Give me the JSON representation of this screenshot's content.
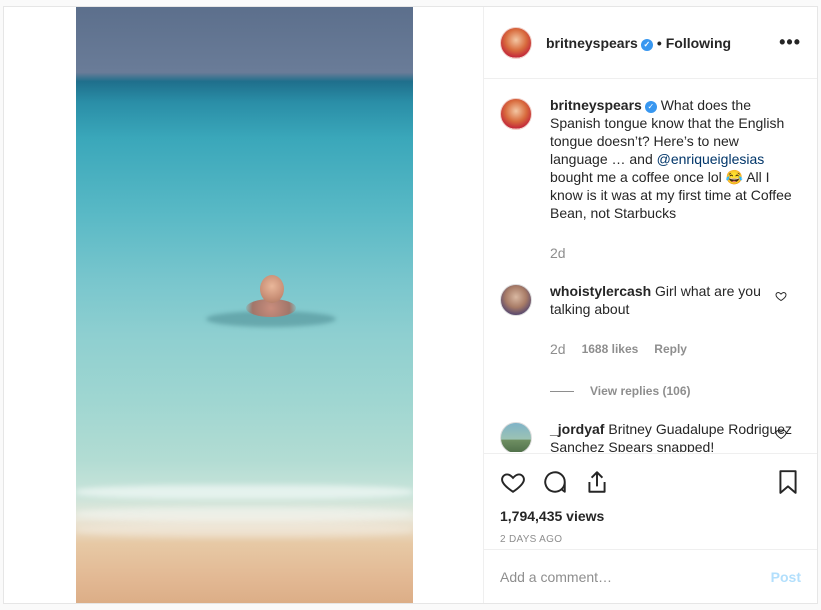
{
  "header": {
    "username": "britneyspears",
    "verified_icon": "verified-badge",
    "separator": "•",
    "follow_status": "Following",
    "more": "•••"
  },
  "caption": {
    "username": "britneyspears",
    "part1": " What does the Spanish tongue know that the English tongue doesn’t? Here’s to new language … and ",
    "mention": "@enriqueiglesias",
    "part2": " bought me a coffee once lol 😂 All I know is it was at my first time at Coffee Bean, not Starbucks",
    "time": "2d"
  },
  "comments": [
    {
      "username": "whoistylercash",
      "text": " Girl what are you talking about",
      "time": "2d",
      "likes": "1688 likes",
      "reply": "Reply",
      "view_replies": "View replies (106)"
    },
    {
      "username": "_jordyaf",
      "text": " Britney Guadalupe Rodriguez Sanchez Spears snapped!"
    }
  ],
  "stats": {
    "views": "1,794,435 views",
    "date": "2 DAYS AGO"
  },
  "composer": {
    "placeholder": "Add a comment…",
    "post_label": "Post"
  },
  "colors": {
    "link": "#003569",
    "muted": "#8e8e8e",
    "verified": "#3897f0",
    "post_disabled": "#b2dffc"
  }
}
